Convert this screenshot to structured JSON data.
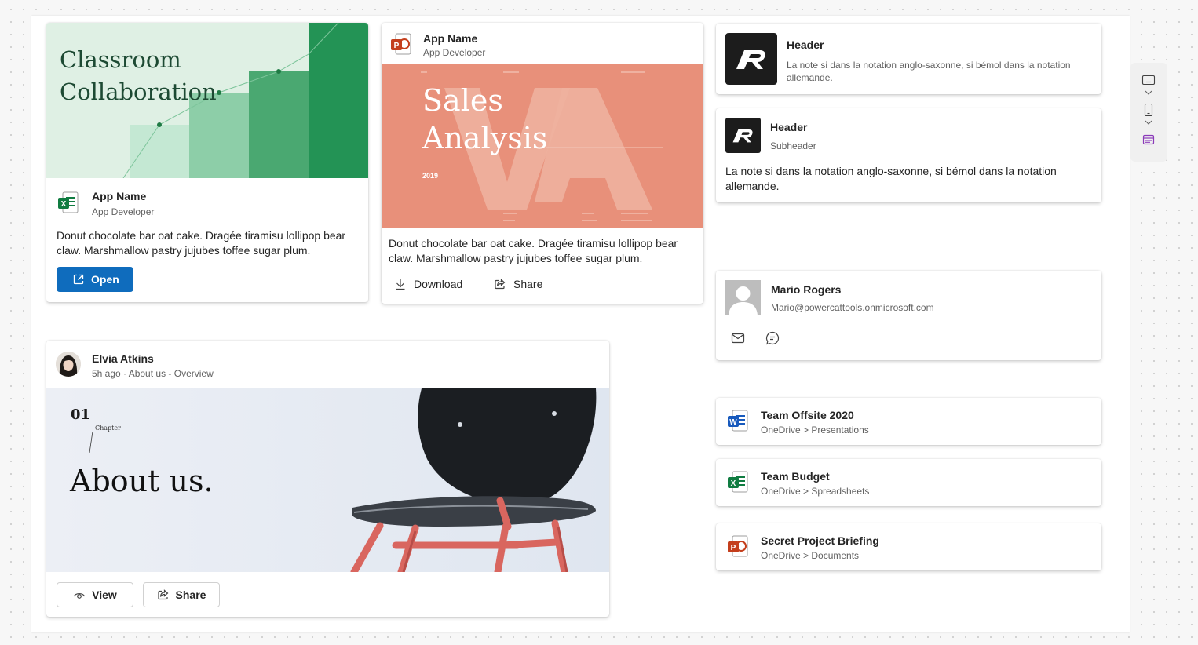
{
  "card_excel": {
    "thumb_title_line1": "Classroom",
    "thumb_title_line2": "Collaboration",
    "app_name": "App Name",
    "app_dev": "App Developer",
    "description": "Donut chocolate bar oat cake. Dragée tiramisu lollipop bear claw. Marshmallow pastry jujubes toffee sugar plum.",
    "open_label": "Open",
    "file_icon": "excel-icon",
    "button_icon": "open-external-icon",
    "color_accent": "#0f6cbd",
    "color_excel": "#107c41"
  },
  "card_ppt": {
    "app_name": "App Name",
    "app_dev": "App Developer",
    "thumb_line1": "Sales",
    "thumb_line2": "Analysis",
    "thumb_year": "2019",
    "description": "Donut chocolate bar oat cake. Dragée tiramisu lollipop bear claw. Marshmallow pastry jujubes toffee sugar plum.",
    "download_label": "Download",
    "share_label": "Share",
    "file_icon": "powerpoint-icon",
    "color_thumb": "#e8907a",
    "color_ppt": "#c43e1c"
  },
  "header_card_1": {
    "title": "Header",
    "text": "La note si dans la notation anglo-saxonne, si bémol dans la notation allemande.",
    "logo": "r-logo"
  },
  "header_card_2": {
    "title": "Header",
    "subheader": "Subheader",
    "text": "La note si dans la notation anglo-saxonne, si bémol dans la notation allemande.",
    "logo": "r-logo"
  },
  "person_card": {
    "name": "Mario Rogers",
    "email": "Mario@powercattools.onmicrosoft.com",
    "mail_icon": "mail-icon",
    "chat_icon": "chat-icon"
  },
  "post_card": {
    "author": "Elvia Atkins",
    "meta": "5h ago · About us - Overview",
    "chapter_num": "01",
    "chapter_label": "Chapter",
    "hero_text": "About us.",
    "view_label": "View",
    "share_label": "Share"
  },
  "files": [
    {
      "name": "Team Offsite 2020",
      "path": "OneDrive > Presentations",
      "icon": "word-icon"
    },
    {
      "name": "Team Budget",
      "path": "OneDrive > Spreadsheets",
      "icon": "excel-icon"
    },
    {
      "name": "Secret Project Briefing",
      "path": "OneDrive > Documents",
      "icon": "powerpoint-icon"
    }
  ],
  "right_toolbar": {
    "icons": [
      "desktop-icon",
      "chevron-down-icon",
      "mobile-icon",
      "chevron-down-icon",
      "card-view-icon"
    ],
    "color_active": "#8a3ab9"
  }
}
